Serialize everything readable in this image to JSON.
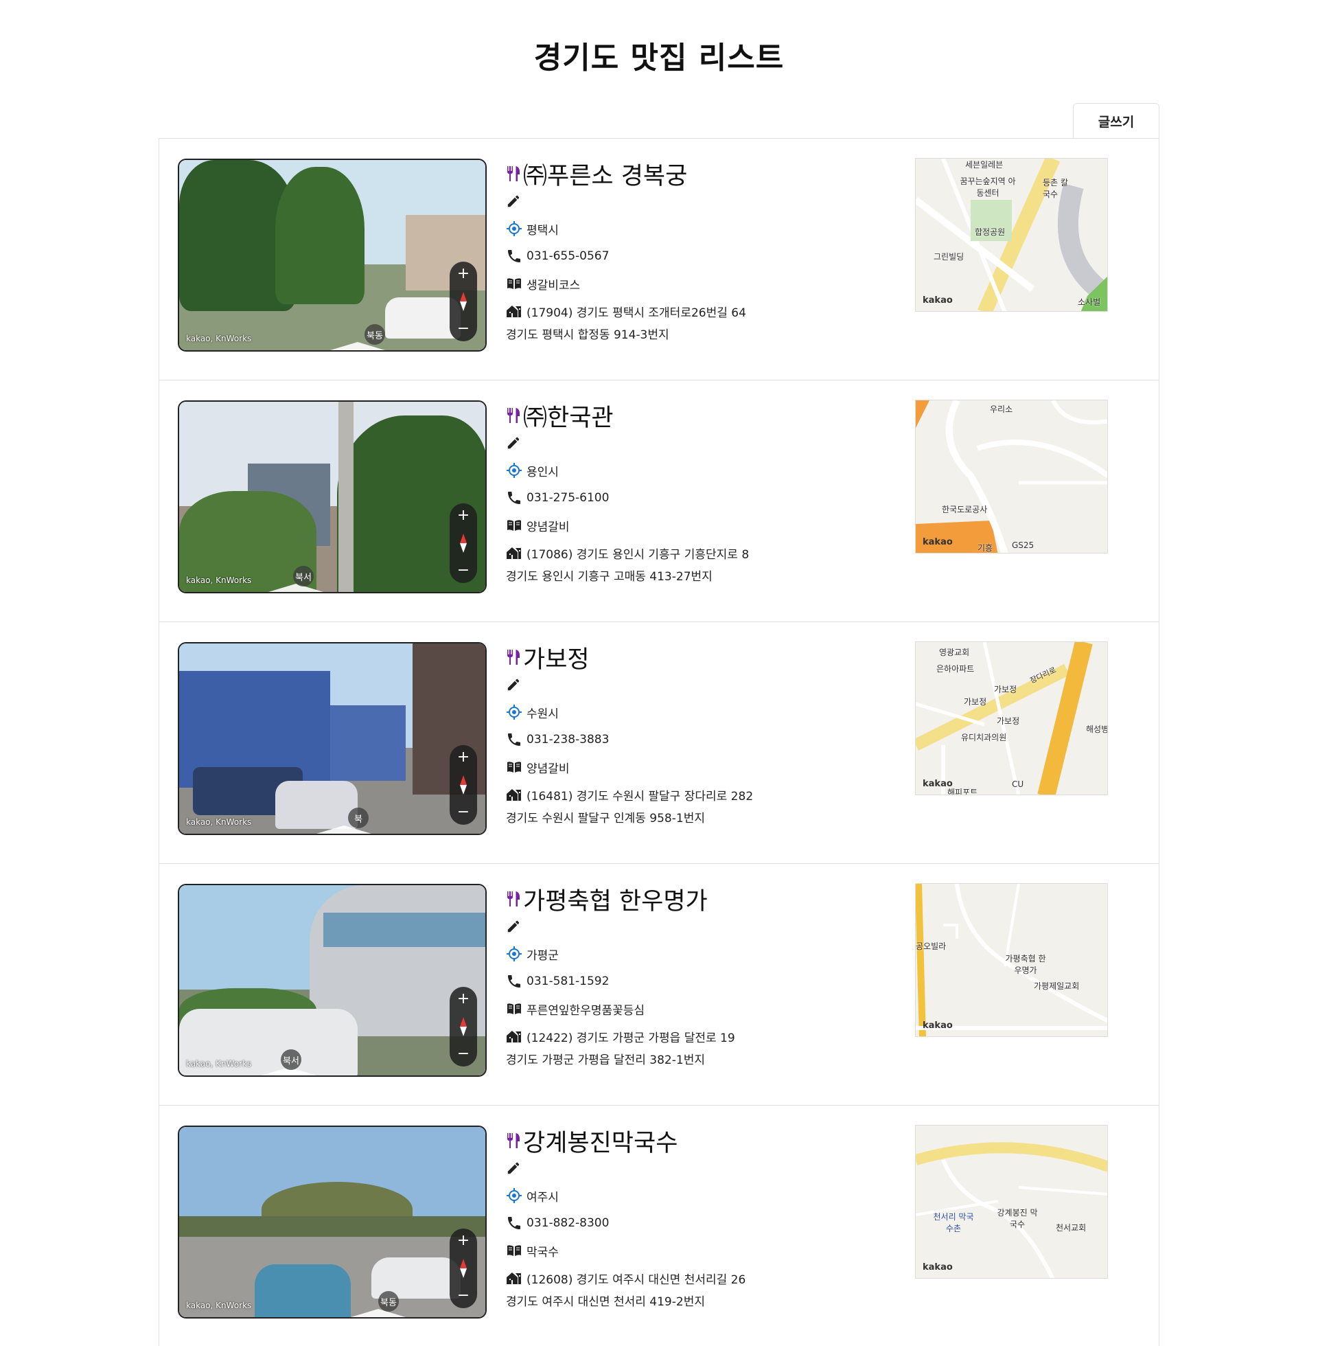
{
  "header": {
    "title": "경기도 맛집 리스트",
    "write_button": "글쓰기"
  },
  "colors": {
    "icon_accent": "#7b1fa2",
    "location_icon": "#1976d2"
  },
  "restaurants": [
    {
      "name": "㈜푸른소 경복궁",
      "city": "평택시",
      "phone": "031-655-0567",
      "menu": "생갈비코스",
      "road_address": "(17904) 경기도 평택시 조개터로26번길 64",
      "jibun_address": "경기도 평택시 합정동 914-3번지",
      "roadview": {
        "credit": "kakao, KnWorks",
        "direction": "북동"
      },
      "map": {
        "logo": "kakao",
        "labels": [
          "세븐일레븐",
          "꿈꾸는숲지역 아동센터",
          "합정공원",
          "그린빌딩",
          "등촌 칼국수",
          "소사벌"
        ]
      }
    },
    {
      "name": "㈜한국관",
      "city": "용인시",
      "phone": "031-275-6100",
      "menu": "양념갈비",
      "road_address": "(17086) 경기도 용인시 기흥구 기흥단지로 8",
      "jibun_address": "경기도 용인시 기흥구 고매동 413-27번지",
      "roadview": {
        "credit": "kakao, KnWorks",
        "direction": "북서"
      },
      "map": {
        "logo": "kakao",
        "labels": [
          "우리소",
          "한국도로공사",
          "GS25",
          "기흥"
        ]
      }
    },
    {
      "name": "가보정",
      "city": "수원시",
      "phone": "031-238-3883",
      "menu": "양념갈비",
      "road_address": "(16481) 경기도 수원시 팔달구 장다리로 282",
      "jibun_address": "경기도 수원시 팔달구 인계동 958-1번지",
      "roadview": {
        "credit": "kakao, KnWorks",
        "direction": "북"
      },
      "map": {
        "logo": "kakao",
        "labels": [
          "영광교회",
          "은하아파트",
          "가보정",
          "가보정",
          "가보정",
          "유디치과의원",
          "해성병",
          "CU",
          "해피포트",
          "장다리로"
        ]
      }
    },
    {
      "name": "가평축협 한우명가",
      "city": "가평군",
      "phone": "031-581-1592",
      "menu": "푸른연잎한우명품꽃등심",
      "road_address": "(12422) 경기도 가평군 가평읍 달전로 19",
      "jibun_address": "경기도 가평군 가평읍 달전리 382-1번지",
      "roadview": {
        "credit": "kakao, KnWorks",
        "direction": "북서"
      },
      "map": {
        "logo": "kakao",
        "labels": [
          "공오빌라",
          "가평축협 한우명가",
          "가평제일교회"
        ]
      }
    },
    {
      "name": "강계봉진막국수",
      "city": "여주시",
      "phone": "031-882-8300",
      "menu": "막국수",
      "road_address": "(12608) 경기도 여주시 대신면 천서리길 26",
      "jibun_address": "경기도 여주시 대신면 천서리 419-2번지",
      "roadview": {
        "credit": "kakao, KnWorks",
        "direction": "북동"
      },
      "map": {
        "logo": "kakao",
        "labels": [
          "천서리 막국수촌",
          "강계봉진 막국수",
          "천서교회"
        ]
      }
    }
  ]
}
